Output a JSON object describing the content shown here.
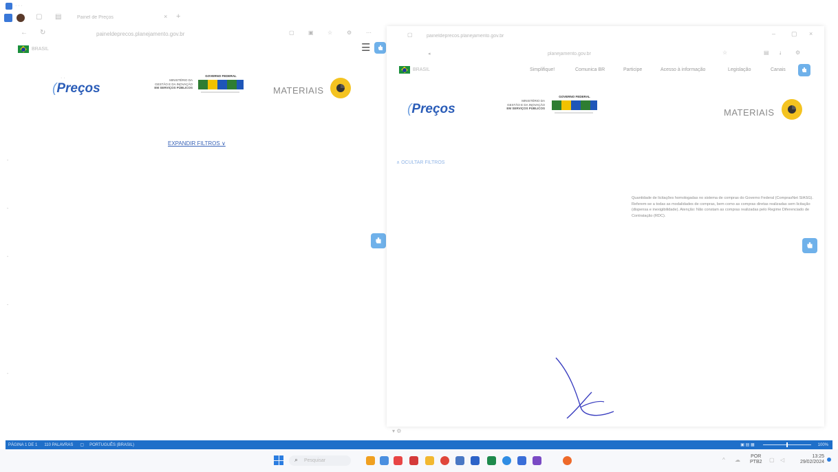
{
  "left": {
    "browser": {
      "tab_title": "Painel de Preços",
      "url": "paineldeprecos.planejamento.gov.br"
    },
    "gov_brasil": "BRASIL",
    "logo": "Preços",
    "ministerio": [
      "MINISTÉRIO DA",
      "GESTÃO E DA INOVAÇÃO",
      "EM SERVIÇOS PÚBLICOS"
    ],
    "governo_federal": "GOVERNO FEDERAL",
    "materiais": "MATERIAIS",
    "expandir_filtros": "EXPANDIR FILTROS ∨"
  },
  "right": {
    "browser": {
      "tab_title": "paineldeprecos.planejamento.gov.br",
      "url": "planejamento.gov.br"
    },
    "gov_brasil": "BRASIL",
    "nav": [
      "Simplifique!",
      "Comunica BR",
      "Participe",
      "Acesso à informação",
      "Legislação",
      "Canais"
    ],
    "logo": "Preços",
    "ministerio": [
      "MINISTÉRIO DA",
      "GESTÃO E DA INOVAÇÃO",
      "EM SERVIÇOS PÚBLICOS"
    ],
    "governo_federal": "GOVERNO FEDERAL",
    "materiais": "MATERIAIS",
    "ocultar_filtros": "∧ OCULTAR FILTROS",
    "info_text": "Quantidade de licitações homologadas no sistema de compras do Governo Federal (ComprasNet SIASG). Referem-se a todas as modalidades de compras, bem como as compras diretas realizadas sem licitação (dispensa e inexigibilidade). Atenção: Não constam as compras realizadas pelo Regime Diferenciado de Contratação (RDC)."
  },
  "word_status": {
    "page": "PÁGINA 1 DE 1",
    "words": "110 PALAVRAS",
    "language": "PORTUGUÊS (BRASIL)",
    "zoom": "100%"
  },
  "taskbar": {
    "search_placeholder": "Pesquisar",
    "lang": "POR",
    "layout": "PTB2",
    "time": "13:25",
    "date": "29/02/2024"
  },
  "colors": {
    "accent": "#6fb1ea",
    "status_bar": "#1f6fc9",
    "logo_blue": "#2b5db8",
    "yellow": "#f4c320"
  }
}
